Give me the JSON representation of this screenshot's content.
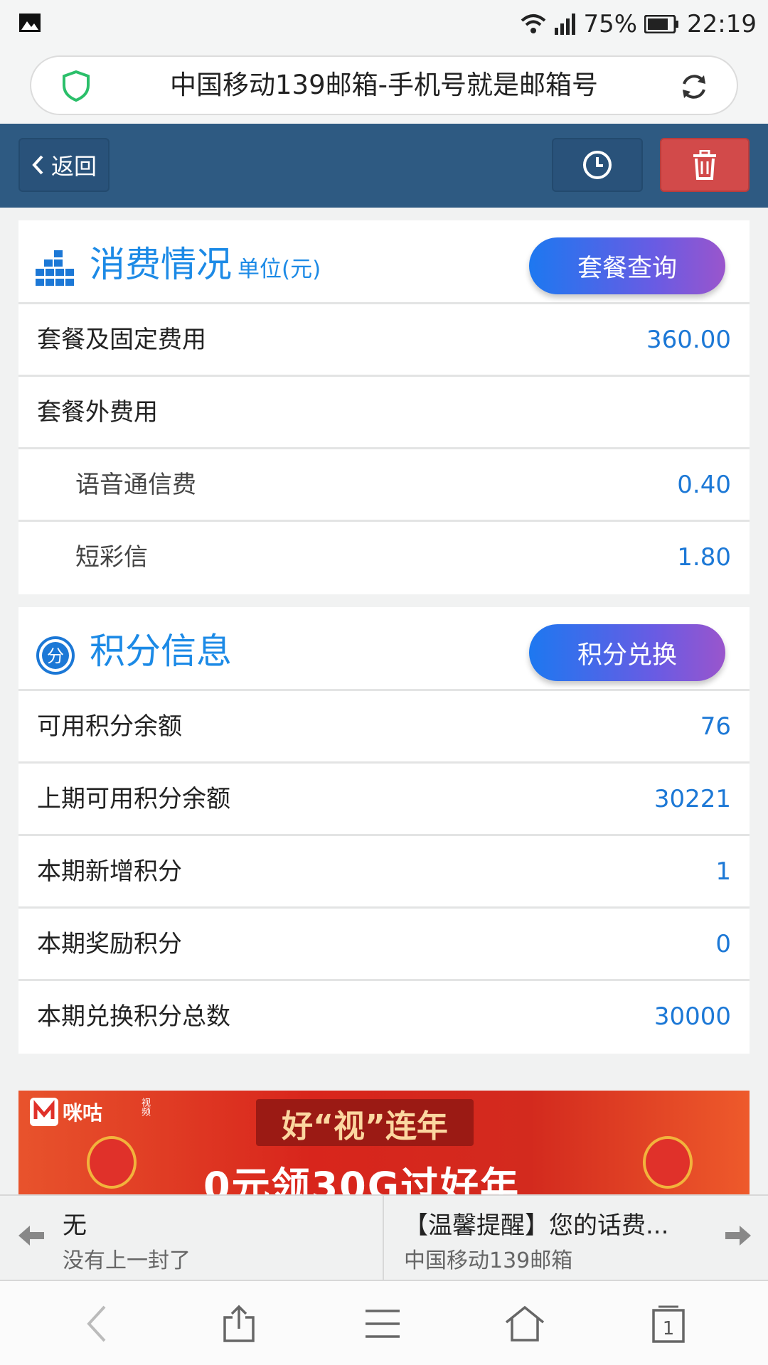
{
  "status_bar": {
    "battery": "75%",
    "time": "22:19"
  },
  "url_bar": {
    "title": "中国移动139邮箱-手机号就是邮箱号"
  },
  "header": {
    "back_label": "返回"
  },
  "consumption": {
    "title": "消费情况",
    "unit": "单位(元)",
    "button": "套餐查询",
    "rows": [
      {
        "label": "套餐及固定费用",
        "value": "360.00"
      },
      {
        "label": "套餐外费用",
        "value": ""
      },
      {
        "label": "语音通信费",
        "value": "0.40"
      },
      {
        "label": "短彩信",
        "value": "1.80"
      }
    ]
  },
  "points": {
    "title": "积分信息",
    "badge": "分",
    "button": "积分兑换",
    "rows": [
      {
        "label": "可用积分余额",
        "value": "76"
      },
      {
        "label": "上期可用积分余额",
        "value": "30221"
      },
      {
        "label": "本期新增积分",
        "value": "1"
      },
      {
        "label": "本期奖励积分",
        "value": "0"
      },
      {
        "label": "本期兑换积分总数",
        "value": "30000"
      }
    ]
  },
  "banner": {
    "logo_text": "咪咕",
    "logo_sub": "视频",
    "slogan": "好“视”连年",
    "promo": "0元领30G过好年"
  },
  "mail_nav": {
    "prev_title": "无",
    "prev_sub": "没有上一封了",
    "next_title": "【温馨提醒】您的话费...",
    "next_sub": "中国移动139邮箱"
  },
  "browser_bar": {
    "tabs_count": "1"
  },
  "colors": {
    "header": "#2e5a82",
    "accent": "#1c8ae6",
    "delete": "#d24a4a"
  }
}
